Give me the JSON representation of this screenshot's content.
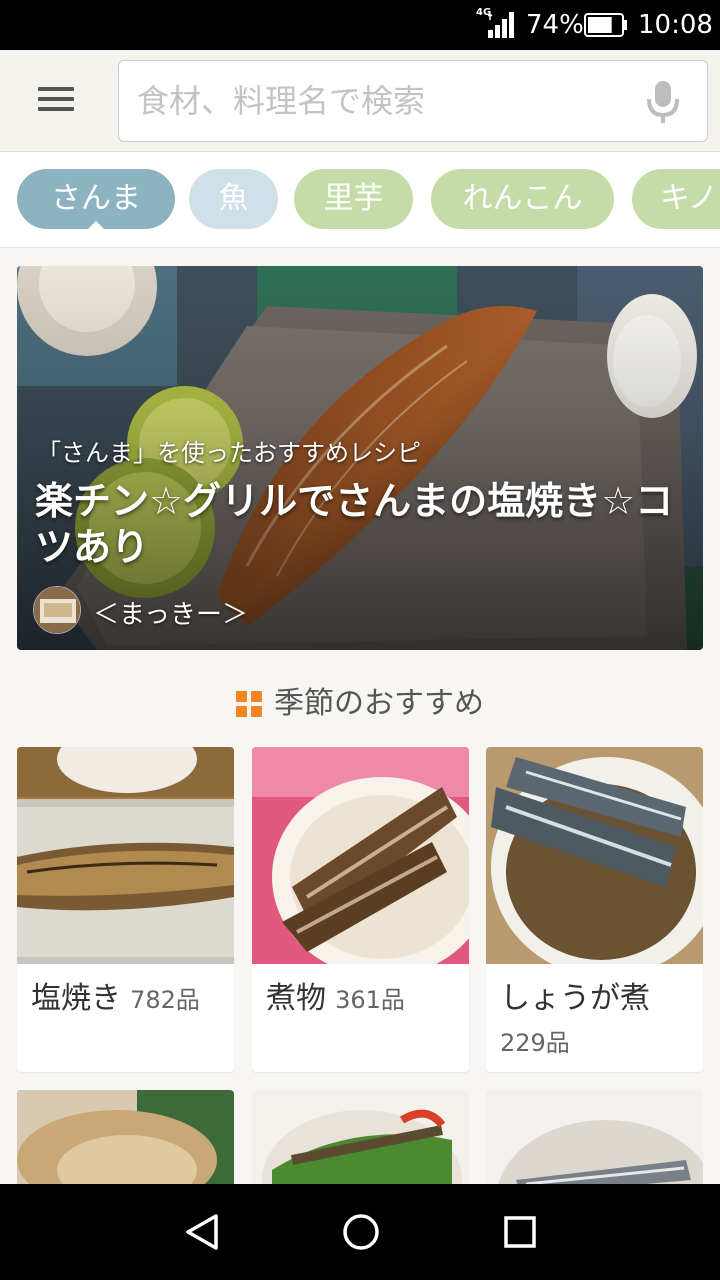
{
  "status_bar": {
    "network": "4G",
    "battery_percent": "74%",
    "battery_level": 0.74,
    "time": "10:08"
  },
  "header": {
    "menu_icon": "hamburger-menu-icon",
    "search_placeholder": "食材、料理名で検索",
    "search_value": "",
    "mic_icon": "microphone-icon"
  },
  "categories": [
    {
      "label": "さんま",
      "selected": true
    },
    {
      "label": "魚",
      "selected": false
    },
    {
      "label": "里芋",
      "selected": false
    },
    {
      "label": "れんこん",
      "selected": false
    },
    {
      "label": "キノコ",
      "selected": false
    }
  ],
  "hero": {
    "caption": "「さんま」を使ったおすすめレシピ",
    "title": "楽チン☆グリルでさんまの塩焼き☆コツあり",
    "author": "＜まっきー＞"
  },
  "section": {
    "title": "季節のおすすめ",
    "icon": "grid-icon",
    "accent_color": "#f08322"
  },
  "recipes": [
    {
      "name": "塩焼き",
      "count": "782品"
    },
    {
      "name": "煮物",
      "count": "361品"
    },
    {
      "name": "しょうが煮",
      "count": "229品"
    }
  ],
  "colors": {
    "chip_selected": "#8db2c2",
    "chip_fish": "#cfe0e8",
    "chip_vegetable": "#c5dca8"
  },
  "nav_bar": {
    "back_icon": "back-triangle-icon",
    "home_icon": "home-circle-icon",
    "recents_icon": "recents-square-icon"
  }
}
